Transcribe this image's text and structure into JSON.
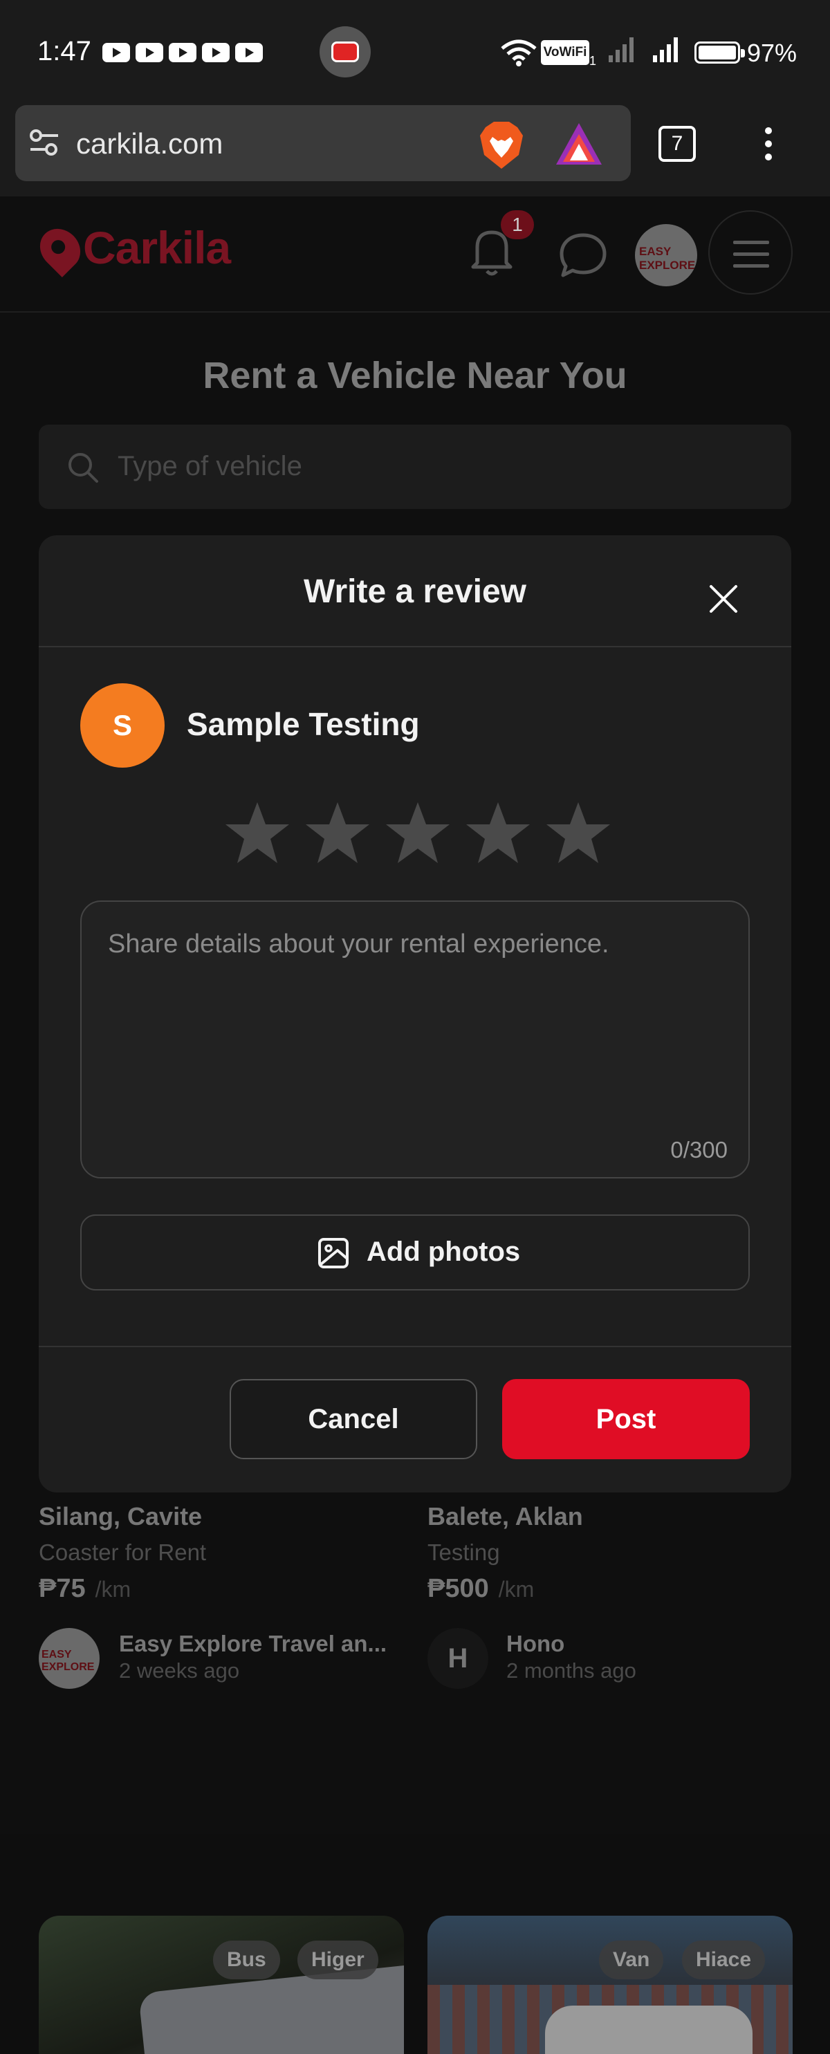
{
  "status_bar": {
    "time": "1:47",
    "battery": "97%",
    "wifi_label": "VoWiFi",
    "sim": "1"
  },
  "browser": {
    "url": "carkila.com",
    "tab_count": "7"
  },
  "site": {
    "brand": "Carkila",
    "notification_count": "1",
    "avatar_text": "EASY EXPLORE",
    "hero_title": "Rent a Vehicle Near You",
    "search_placeholder": "Type of vehicle"
  },
  "listings": [
    {
      "location": "Silang, Cavite",
      "subtitle": "Coaster for Rent",
      "price": "₱75",
      "unit": "/km",
      "owner": "Easy Explore Travel an...",
      "ago": "2 weeks ago",
      "owner_avatar_text": "EASY EXPLORE",
      "tags": [
        "Bus",
        "Higer"
      ]
    },
    {
      "location": "Balete, Aklan",
      "subtitle": "Testing",
      "price": "₱500",
      "unit": "/km",
      "owner": "Hono",
      "ago": "2 months ago",
      "owner_avatar_text": "H",
      "tags": [
        "Van",
        "Hiace"
      ]
    }
  ],
  "modal": {
    "title": "Write a review",
    "user_initial": "S",
    "user_name": "Sample Testing",
    "rating": 0,
    "rating_max": 5,
    "textarea_placeholder": "Share details about your rental experience.",
    "char_count": "0/300",
    "add_photos_label": "Add photos",
    "cancel_label": "Cancel",
    "post_label": "Post"
  },
  "colors": {
    "accent": "#e00d25",
    "avatar_orange": "#f47c20",
    "modal_bg": "#1e1e1e"
  }
}
